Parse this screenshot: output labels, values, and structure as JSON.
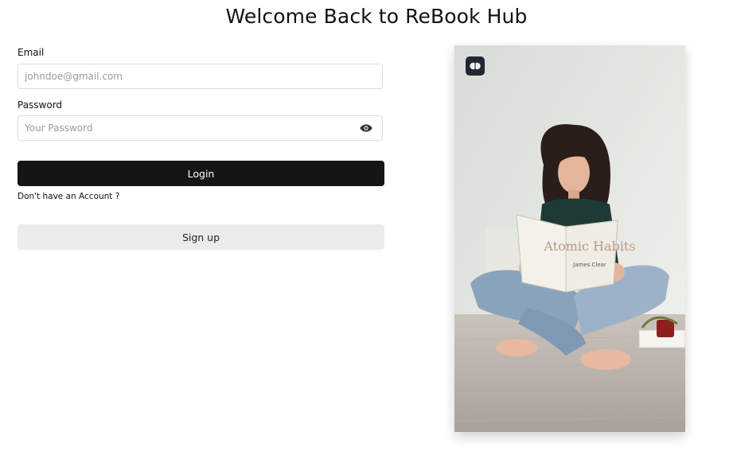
{
  "header": {
    "title": "Welcome Back to ReBook Hub"
  },
  "form": {
    "email_label": "Email",
    "email_placeholder": "johndoe@gmail.com",
    "password_label": "Password",
    "password_placeholder": "Your Password",
    "login_label": "Login",
    "no_account_text": "Don't have an Account ?",
    "signup_label": "Sign up"
  },
  "hero": {
    "image_icon": "image-illustration",
    "badge_icon": "brain-icon",
    "book_title": "Atomic Habits",
    "book_author": "James Clear"
  },
  "colors": {
    "primary_button": "#151515",
    "secondary_button": "#ececec",
    "badge": "#222733"
  }
}
